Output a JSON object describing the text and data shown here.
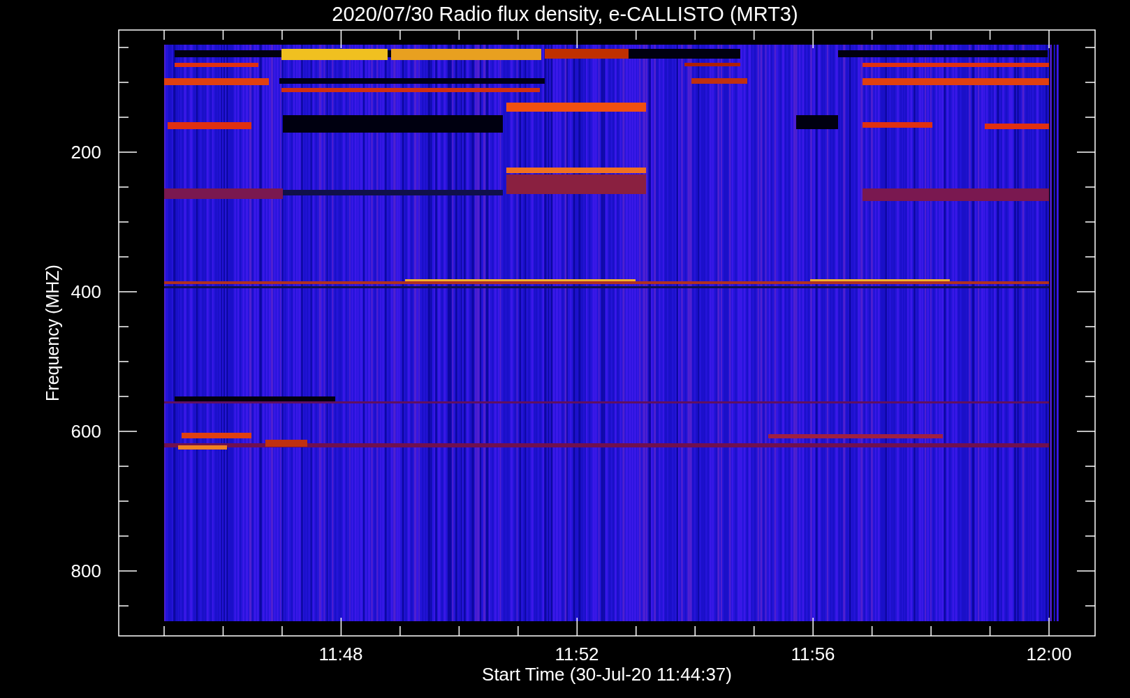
{
  "title": "2020/07/30  Radio flux density, e-CALLISTO (MRT3)",
  "y_axis": {
    "label": "Frequency (MHZ)",
    "ticks": [
      "200",
      "400",
      "600",
      "800"
    ]
  },
  "x_axis": {
    "label": "Start Time (30-Jul-20 11:44:37)",
    "ticks": [
      "11:48",
      "11:52",
      "11:56",
      "12:00"
    ]
  }
}
